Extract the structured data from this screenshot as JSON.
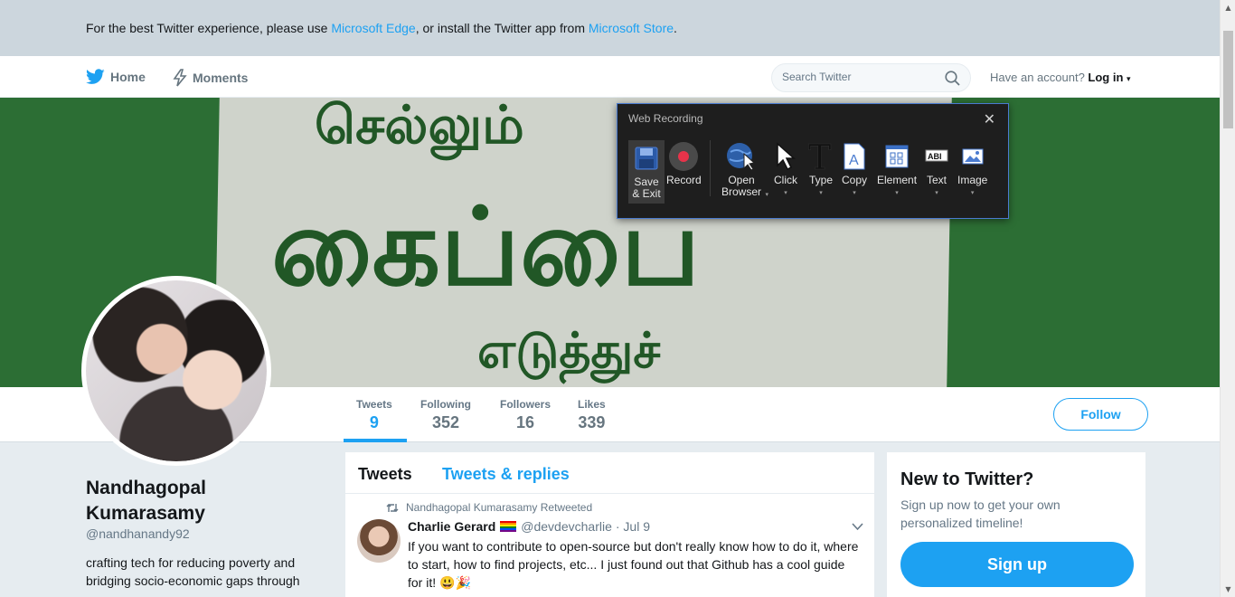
{
  "notice": {
    "text_before": "For the best Twitter experience, please use ",
    "link_edge": "Microsoft Edge",
    "text_middle": ", or install the Twitter app from ",
    "link_store": "Microsoft Store",
    "text_after": "."
  },
  "nav": {
    "home_label": "Home",
    "moments_label": "Moments",
    "search_placeholder": "Search Twitter",
    "have_account": "Have an account?",
    "login_label": "Log in"
  },
  "banner": {
    "line1": "செல்லும் ",
    "line2": "கைப்பை",
    "line3": "எடுத்துச்"
  },
  "stats": [
    {
      "label": "Tweets",
      "value": "9"
    },
    {
      "label": "Following",
      "value": "352"
    },
    {
      "label": "Followers",
      "value": "16"
    },
    {
      "label": "Likes",
      "value": "339"
    }
  ],
  "follow_label": "Follow",
  "profile": {
    "name": "Nandhagopal Kumarasamy",
    "handle": "@nandhanandy92",
    "bio": "crafting tech for reducing poverty and bridging socio-economic gaps through"
  },
  "timeline": {
    "tabs": [
      "Tweets",
      "Tweets & replies"
    ],
    "tweet": {
      "retweet_context": "Nandhagopal Kumarasamy Retweeted",
      "author": "Charlie Gerard",
      "handle": "@devdevcharlie",
      "date": "· Jul 9",
      "text": "If you want to contribute to open-source but don't really know how to do it, where to start, how to find projects, etc... I just found out that Github has a cool guide for it! 😃🎉"
    }
  },
  "signup": {
    "title": "New to Twitter?",
    "subtitle": "Sign up now to get your own personalized timeline!",
    "button": "Sign up"
  },
  "recorder": {
    "title": "Web Recording",
    "tools": {
      "save": "Save & Exit",
      "record": "Record",
      "open": "Open Browser",
      "click": "Click",
      "type": "Type",
      "copy": "Copy",
      "element": "Element",
      "text": "Text",
      "image": "Image"
    }
  },
  "colors": {
    "twitter_blue": "#1da1f2",
    "record_red": "#e8334a",
    "banner_green": "#2c6e34"
  }
}
